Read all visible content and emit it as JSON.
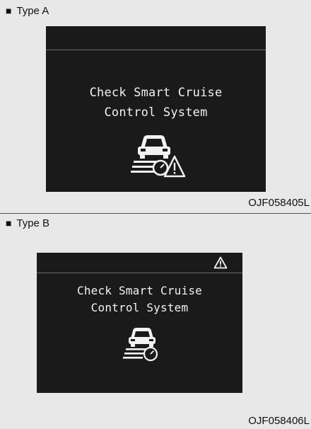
{
  "sections": [
    {
      "label_prefix": "■",
      "label": "Type A",
      "message_line1": "Check Smart Cruise",
      "message_line2": "Control System",
      "caption": "OJF058405L",
      "icon": "scc-car-gauge-warning-icon"
    },
    {
      "label_prefix": "■",
      "label": "Type B",
      "message_line1": "Check Smart Cruise",
      "message_line2": "Control System",
      "caption": "OJF058406L",
      "icon": "scc-car-gauge-icon",
      "top_icon": "warning-triangle-icon"
    }
  ],
  "colors": {
    "page_background": "#e8e8e8",
    "screen_background": "#1a1a1a",
    "screen_text": "#f2f2f2"
  }
}
